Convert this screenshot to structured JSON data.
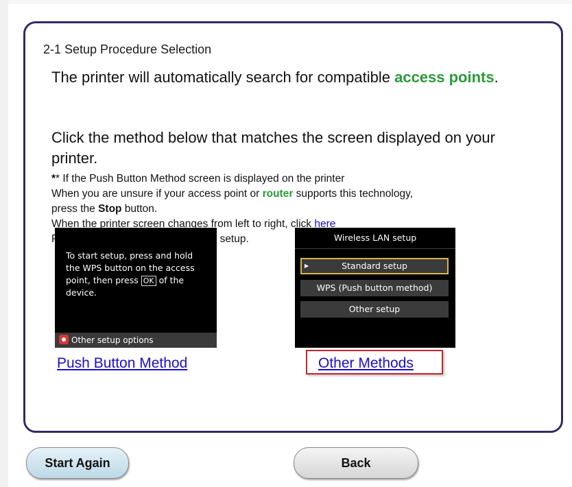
{
  "step_title": "2-1 Setup Procedure Selection",
  "headline": {
    "part1": "The printer will automatically search for compatible ",
    "green": "access points",
    "part2": "."
  },
  "instruction": "Click the method below that matches the screen displayed on your printer.",
  "notes": {
    "line1": "* If the Push Button Method screen is displayed on the printer",
    "line2_a": "When you are unsure if your access point or ",
    "line2_green": "router",
    "line2_b": " supports this technology,",
    "line3_a": "press the ",
    "line3_bold": "Stop",
    "line3_b": " button.",
    "line4_a": "When the printer screen changes from left to right, click ",
    "line4_link": "here",
    "line5": "Proceed to the screen for Standard setup."
  },
  "push_screen": {
    "message_a": "To start setup, press and hold the WPS button on the access point, then press ",
    "ok_label": "OK",
    "message_b": " of the device.",
    "bottom_label": "Other setup options"
  },
  "wireless_screen": {
    "header": "Wireless LAN setup",
    "items": [
      "Standard setup",
      "WPS (Push button method)",
      "Other setup"
    ]
  },
  "links": {
    "push_button": "Push Button Method",
    "other_methods": "Other Methods"
  },
  "buttons": {
    "start_again": "Start Again",
    "back": "Back"
  },
  "colors": {
    "panel_border": "#332a66",
    "green_text": "#2a9a3a",
    "link": "#1a0dcc",
    "highlight": "#c8242c"
  }
}
